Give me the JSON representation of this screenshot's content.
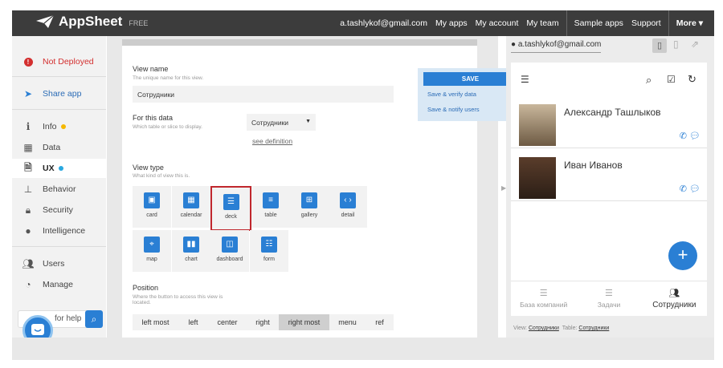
{
  "topbar": {
    "brand": "AppSheet",
    "free": "FREE",
    "email": "a.tashlykof@gmail.com",
    "nav": [
      "My apps",
      "My account",
      "My team"
    ],
    "nav2": [
      "Sample apps",
      "Support"
    ],
    "more": "More ▾"
  },
  "sidebar": {
    "status": "Not Deployed",
    "share": "Share app",
    "items": [
      "Info",
      "Data",
      "UX",
      "Behavior",
      "Security",
      "Intelligence"
    ],
    "items2": [
      "Users",
      "Manage"
    ],
    "search_placeholder": "for help"
  },
  "editor": {
    "view_name_label": "View name",
    "view_name_sub": "The unique name for this view.",
    "view_name_value": "Сотрудники",
    "data_label": "For this data",
    "data_sub": "Which table or slice to display.",
    "data_value": "Сотрудники",
    "see_definition": "see definition",
    "view_type_label": "View type",
    "view_type_sub": "What kind of view this is.",
    "view_types": [
      "card",
      "calendar",
      "deck",
      "table",
      "gallery",
      "detail",
      "map",
      "chart",
      "dashboard",
      "form"
    ],
    "selected_view_type": "deck",
    "position_label": "Position",
    "position_sub": "Where the button to access this view is located.",
    "positions": [
      "left most",
      "left",
      "center",
      "right",
      "right most",
      "menu",
      "ref"
    ],
    "selected_position": "right most"
  },
  "save": {
    "save": "SAVE",
    "verify": "Save & verify data",
    "notify": "Save & notify users"
  },
  "preview": {
    "account": "a.tashlykof@gmail.com",
    "people": [
      "Александр Ташлыков",
      "Иван Иванов"
    ],
    "tabs": [
      "База компаний",
      "Задачи",
      "Сотрудники"
    ],
    "active_tab": "Сотрудники",
    "footer_view_label": "View:",
    "footer_view": "Сотрудники",
    "footer_table_label": "Table:",
    "footer_table": "Сотрудники"
  },
  "colors": {
    "accent": "#2a7fd4",
    "topbar": "#3c3c3c",
    "danger": "#d32f2f",
    "selected_border": "#c0272d"
  }
}
